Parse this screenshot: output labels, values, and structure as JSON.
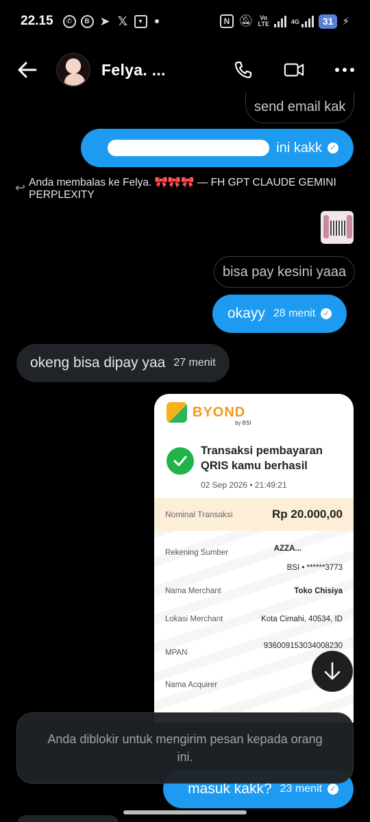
{
  "status_bar": {
    "time": "22.15",
    "nfc": "N",
    "lte_top": "Vo",
    "lte_bottom": "LTE",
    "net_type": "4G",
    "battery": "31",
    "app_icons": [
      "whatsapp-icon",
      "whatsapp-business-icon",
      "telegram-icon",
      "x-icon",
      "shopping-bag-icon"
    ]
  },
  "header": {
    "name": "Felya. ...",
    "icons": [
      "back-arrow-icon",
      "phone-icon",
      "video-icon",
      "more-icon"
    ]
  },
  "messages": [
    {
      "id": "m1",
      "text": "send email kak"
    },
    {
      "id": "m2",
      "text": "ini kakk"
    },
    {
      "id": "m3",
      "text": "bisa pay kesini yaaa"
    },
    {
      "id": "m4",
      "text": "okayy",
      "time": "28 menit"
    },
    {
      "id": "m5",
      "text": "okeng bisa dipay yaa",
      "time": "27 menit"
    },
    {
      "id": "m6",
      "text": "masuk kakk?",
      "time": "23 menit"
    }
  ],
  "reply_context": {
    "text": "Anda membalas ke Felya. 🎀🎀🎀 — FH GPT CLAUDE GEMINI PERPLEXITY"
  },
  "receipt": {
    "brand": "BYOND",
    "brand_sub": "by BSI",
    "title": "Transaksi pembayaran QRIS kamu berhasil",
    "date": "02 Sep 2026 • 21:49:21",
    "amount_label": "Nominal Transaksi",
    "amount_value": "Rp 20.000,00",
    "rows": [
      {
        "label": "Rekening Sumber",
        "value": "AZZA...",
        "value2": "BSI • ******3773"
      },
      {
        "label": "Nama Merchant",
        "value": "Toko Chisiya"
      },
      {
        "label": "Lokasi Merchant",
        "value": "Kota Cimahi, 40534, ID"
      },
      {
        "label": "MPAN",
        "value": "936009153034008230"
      },
      {
        "label": "Nama Acquirer",
        "value": ""
      }
    ]
  },
  "toast": {
    "text": "Anda diblokir untuk mengirim pesan kepada orang ini."
  },
  "colors": {
    "sent_bubble": "#1d9bf0",
    "received_bubble": "#202327",
    "background": "#000000",
    "receipt_highlight": "#fdeed8",
    "success_green": "#21b24a"
  }
}
